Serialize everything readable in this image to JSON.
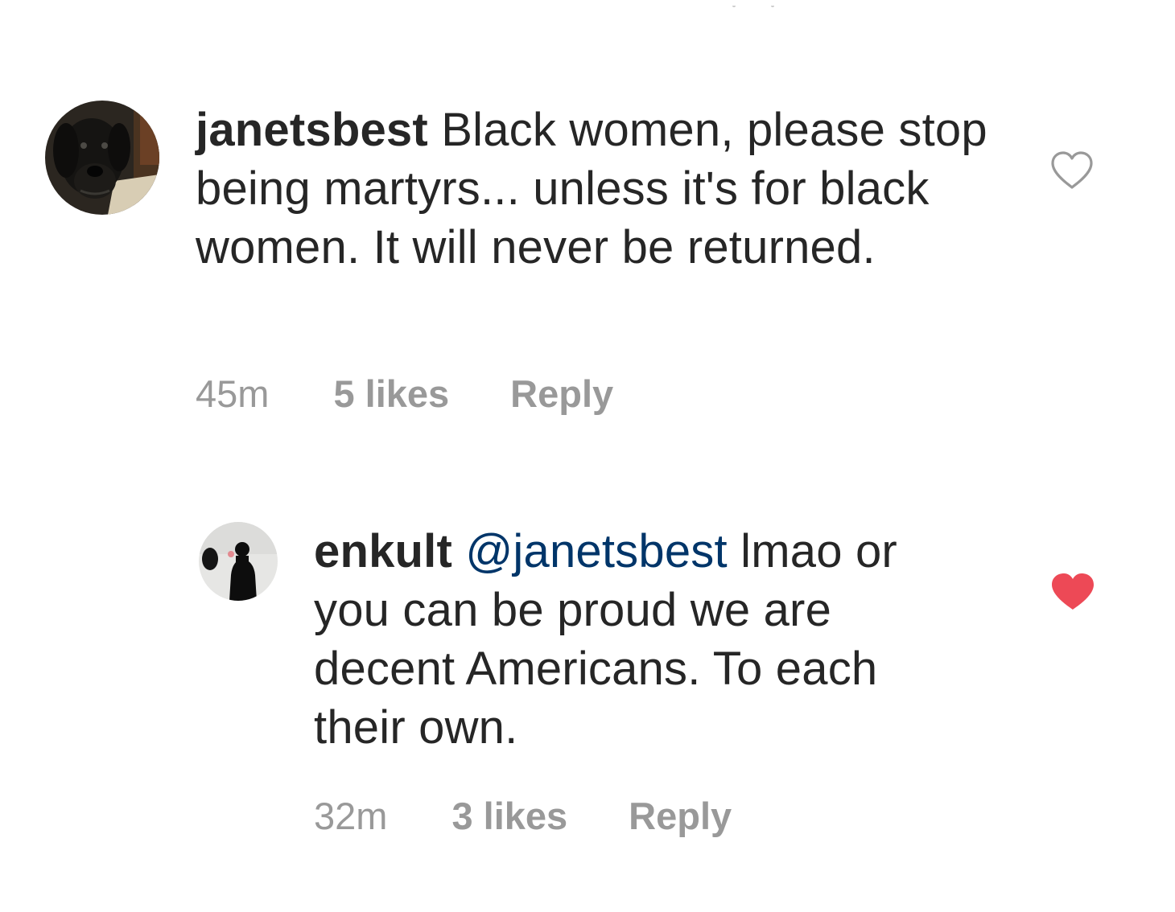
{
  "comments": [
    {
      "username": "janetsbest",
      "mention": "",
      "text": "Black women, please stop being martyrs... unless it's for black women.  It will never be returned.",
      "time": "45m",
      "likes": "5 likes",
      "reply_label": "Reply",
      "liked": false,
      "avatar_icon": "dog-photo-avatar"
    },
    {
      "username": "enkult",
      "mention": "@janetsbest",
      "text": "lmao or you can be proud we are decent Americans. To each their own.",
      "time": "32m",
      "likes": "3 likes",
      "reply_label": "Reply",
      "liked": true,
      "avatar_icon": "silhouette-photo-avatar"
    }
  ],
  "colors": {
    "text": "#262626",
    "meta": "#999999",
    "mention": "#003569",
    "heart_liked": "#ed4956",
    "heart_outline": "#999999"
  }
}
